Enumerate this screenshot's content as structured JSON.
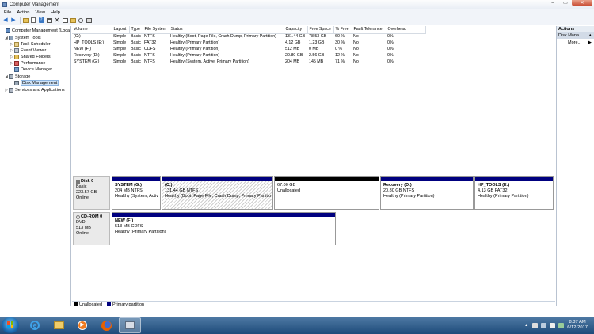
{
  "window": {
    "title": "Computer Management"
  },
  "menu": [
    "File",
    "Action",
    "View",
    "Help"
  ],
  "tree": [
    {
      "label": "Computer Management (Local",
      "depth": 0,
      "expander": "",
      "icon": "computer-icon"
    },
    {
      "label": "System Tools",
      "depth": 1,
      "expander": "◢",
      "icon": "tools-icon"
    },
    {
      "label": "Task Scheduler",
      "depth": 2,
      "expander": "▷",
      "icon": "task-scheduler-icon"
    },
    {
      "label": "Event Viewer",
      "depth": 2,
      "expander": "▷",
      "icon": "event-viewer-icon"
    },
    {
      "label": "Shared Folders",
      "depth": 2,
      "expander": "▷",
      "icon": "shared-folders-icon"
    },
    {
      "label": "Performance",
      "depth": 2,
      "expander": "▷",
      "icon": "performance-icon"
    },
    {
      "label": "Device Manager",
      "depth": 2,
      "expander": "",
      "icon": "device-manager-icon"
    },
    {
      "label": "Storage",
      "depth": 1,
      "expander": "◢",
      "icon": "storage-icon"
    },
    {
      "label": "Disk Management",
      "depth": 2,
      "expander": "",
      "icon": "disk-management-icon",
      "selected": true
    },
    {
      "label": "Services and Applications",
      "depth": 1,
      "expander": "▷",
      "icon": "services-icon"
    }
  ],
  "volume_table": {
    "columns": [
      "Volume",
      "Layout",
      "Type",
      "File System",
      "Status",
      "Capacity",
      "Free Space",
      "% Free",
      "Fault Tolerance",
      "Overhead"
    ],
    "rows": [
      [
        "(C:)",
        "Simple",
        "Basic",
        "NTFS",
        "Healthy (Boot, Page File, Crash Dump, Primary Partition)",
        "131.44 GB",
        "78.53 GB",
        "60 %",
        "No",
        "0%"
      ],
      [
        "HP_TOOLS (E:)",
        "Simple",
        "Basic",
        "FAT32",
        "Healthy (Primary Partition)",
        "4.12 GB",
        "1.23 GB",
        "30 %",
        "No",
        "0%"
      ],
      [
        "NEW (F:)",
        "Simple",
        "Basic",
        "CDFS",
        "Healthy (Primary Partition)",
        "512 MB",
        "0 MB",
        "0 %",
        "No",
        "0%"
      ],
      [
        "Recovery (D:)",
        "Simple",
        "Basic",
        "NTFS",
        "Healthy (Primary Partition)",
        "20.80 GB",
        "2.56 GB",
        "12 %",
        "No",
        "0%"
      ],
      [
        "SYSTEM (G:)",
        "Simple",
        "Basic",
        "NTFS",
        "Healthy (System, Active, Primary Partition)",
        "204 MB",
        "145 MB",
        "71 %",
        "No",
        "0%"
      ]
    ]
  },
  "disk0": {
    "name": "Disk 0",
    "type": "Basic",
    "size": "223.57 GB",
    "status": "Online",
    "partitions": [
      {
        "name": "SYSTEM (G:)",
        "size": "204 MB NTFS",
        "status": "Healthy (System, Activ"
      },
      {
        "name": "(C:)",
        "size": "131.44 GB NTFS",
        "status": "Healthy (Boot, Page File, Crash Dump, Primary Partitio"
      },
      {
        "name": "",
        "size": "67.00 GB",
        "status": "Unallocated"
      },
      {
        "name": "Recovery (D:)",
        "size": "20.80 GB NTFS",
        "status": "Healthy (Primary Partition)"
      },
      {
        "name": "HP_TOOLS (E:)",
        "size": "4.13 GB FAT32",
        "status": "Healthy (Primary Partition)"
      }
    ]
  },
  "cdrom0": {
    "name": "CD-ROM 0",
    "type": "DVD",
    "size": "513 MB",
    "status": "Online",
    "partition": {
      "name": "NEW (F:)",
      "size": "513 MB CDFS",
      "status": "Healthy (Primary Partition)"
    }
  },
  "legend": {
    "unallocated": "Unallocated",
    "primary": "Primary partition"
  },
  "actions": {
    "header": "Actions",
    "section": "Disk Mana...",
    "more": "More..."
  },
  "colors": {
    "primary_partition": "#00007f",
    "unallocated": "#000000",
    "selection": "#cfe3f7"
  },
  "taskbar": {
    "apps": [
      "internet-explorer-icon",
      "file-explorer-icon",
      "media-player-icon",
      "firefox-icon",
      "computer-management-icon"
    ],
    "time": "8:37 AM",
    "date": "6/12/2017"
  }
}
